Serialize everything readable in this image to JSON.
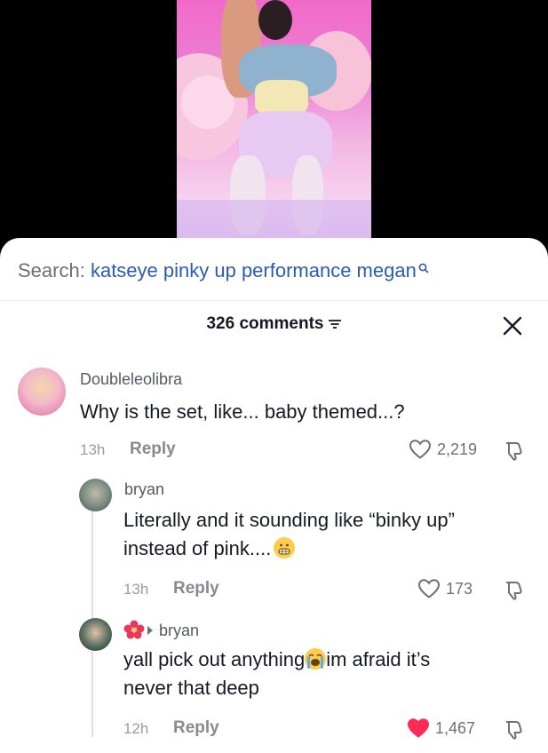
{
  "search": {
    "prefix": "Search:",
    "query": "katseye pinky up performance megan"
  },
  "header": {
    "comments_count": "326 comments"
  },
  "comments": [
    {
      "username": "Doubleleolibra",
      "text": "Why is the set, like... baby themed...?",
      "time": "13h",
      "reply_label": "Reply",
      "likes": "2,219",
      "liked": false
    },
    {
      "username": "bryan",
      "text_line1": "Literally and it sounding like “binky up”",
      "text_line2": "instead of pink....",
      "emoji": "grimacing-face",
      "time": "13h",
      "reply_label": "Reply",
      "likes": "173",
      "liked": false
    },
    {
      "username_emoji": "hibiscus",
      "reply_to": "bryan",
      "text_line1_a": "yall pick out anything",
      "emoji": "loudly-crying-face",
      "text_line1_b": "im afraid it’s",
      "text_line2": "never that deep",
      "time": "12h",
      "reply_label": "Reply",
      "likes": "1,467",
      "liked": true
    }
  ],
  "colors": {
    "liked_heart": "#fe2c55",
    "query_link": "#2a5db0"
  }
}
